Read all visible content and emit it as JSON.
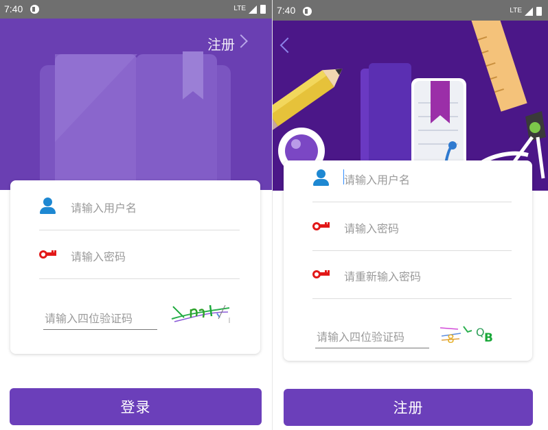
{
  "status_bar": {
    "time": "7:40",
    "network": "LTE"
  },
  "login_screen": {
    "register_link": "注册",
    "username_placeholder": "请输入用户名",
    "password_placeholder": "请输入密码",
    "captcha_placeholder": "请输入四位验证码",
    "login_button": "登录"
  },
  "register_screen": {
    "username_placeholder": "请输入用户名",
    "password_placeholder": "请输入密码",
    "confirm_password_placeholder": "请重新输入密码",
    "captcha_placeholder": "请输入四位验证码",
    "register_button": "注册"
  },
  "colors": {
    "accent_purple": "#6b3fba",
    "user_icon_blue": "#1e88d2",
    "key_icon_red": "#e21818"
  },
  "icons": [
    "user-icon",
    "key-icon",
    "chevron-right-icon",
    "chevron-left-icon",
    "app-indicator-icon",
    "signal-icon",
    "battery-icon"
  ]
}
